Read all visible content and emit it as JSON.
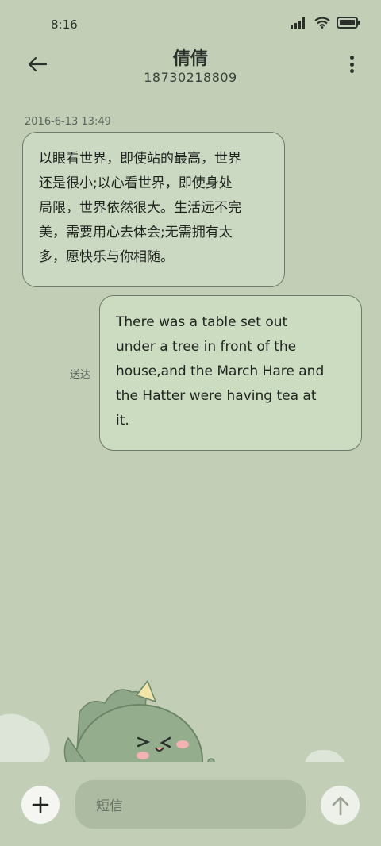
{
  "status_bar": {
    "time": "8:16",
    "icons": [
      "signal-icon",
      "wifi-icon",
      "battery-icon"
    ]
  },
  "header": {
    "contact_name": "倩倩",
    "phone_number": "18730218809",
    "back_icon": "back-arrow-icon",
    "menu_icon": "more-vertical-icon"
  },
  "conversation": {
    "timestamp": "2016-6-13 13:49",
    "messages": [
      {
        "direction": "incoming",
        "lines": [
          "以眼看世界，即使站的最高，世界",
          "还是很小;以心看世界，即使身处",
          "局限，世界依然很大。生活远不完",
          "美，需要用心去体会;无需拥有太",
          "多，愿快乐与你相随。"
        ]
      },
      {
        "direction": "outgoing",
        "lines": [
          "There was a table set out",
          "under a tree in front of the",
          "house,and the March Hare and",
          "the Hatter were having tea at",
          "it."
        ],
        "status": "送达"
      }
    ]
  },
  "composer": {
    "placeholder": "短信",
    "add_icon": "plus-icon",
    "send_icon": "send-arrow-up-icon"
  },
  "colors": {
    "background": "#c2cfb6",
    "bubble_incoming": "#ccd9c2",
    "bubble_outgoing": "#ccdcc0",
    "input_field": "#adbba2"
  }
}
